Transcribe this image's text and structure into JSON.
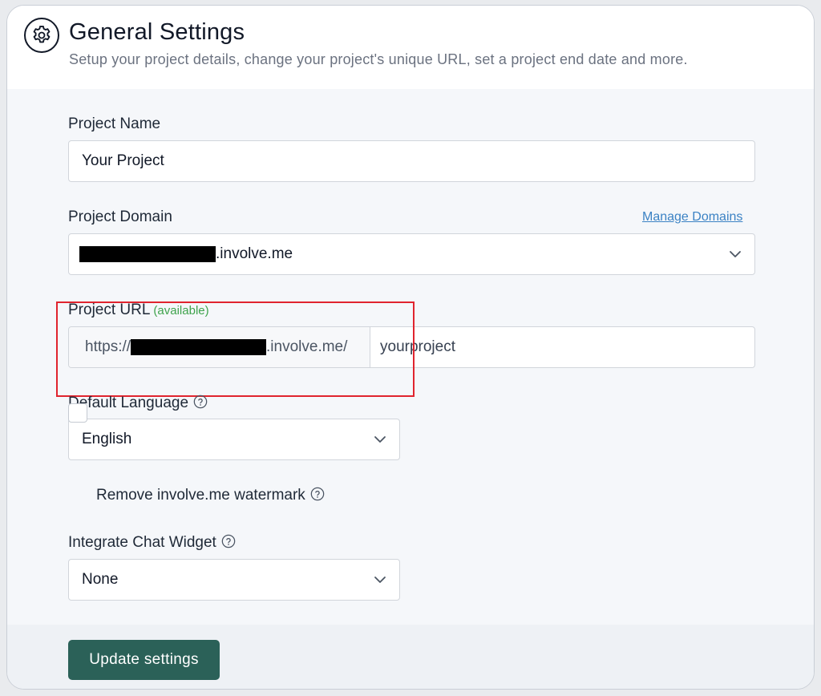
{
  "header": {
    "title": "General Settings",
    "subtitle": "Setup your project details, change your project's unique URL, set a project end date and more."
  },
  "project_name": {
    "label": "Project Name",
    "value": "Your Project"
  },
  "project_domain": {
    "label": "Project Domain",
    "manage_link": "Manage Domains",
    "value_suffix": ".involve.me"
  },
  "project_url": {
    "label": "Project URL",
    "status": "(available)",
    "prefix_start": "https://",
    "prefix_end": ".involve.me/",
    "value": "yourproject"
  },
  "default_language": {
    "label": "Default Language",
    "value": "English"
  },
  "watermark": {
    "label": "Remove involve.me watermark",
    "checked": false
  },
  "chat_widget": {
    "label": "Integrate Chat Widget",
    "value": "None"
  },
  "footer": {
    "button_label": "Update settings"
  },
  "colors": {
    "primary_button": "#2b6158",
    "available_green": "#3fa34d",
    "link_blue": "#3b82c4",
    "highlight_red": "#e0242e"
  },
  "icons": {
    "header": "gear-icon",
    "select": "chevron-down-icon",
    "help": "question-circle-icon"
  }
}
